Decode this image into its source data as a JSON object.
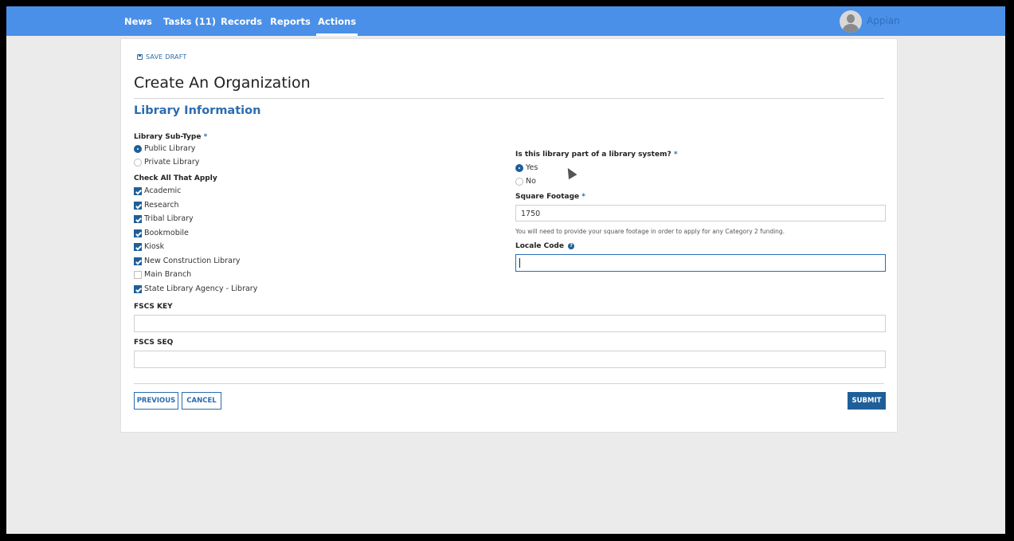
{
  "nav": {
    "tabs": [
      {
        "label": "News"
      },
      {
        "label": "Tasks (11)"
      },
      {
        "label": "Records"
      },
      {
        "label": "Reports"
      },
      {
        "label": "Actions"
      }
    ],
    "active_tab": "Actions",
    "app_name": "Appian"
  },
  "form": {
    "save_draft_label": "SAVE DRAFT",
    "title": "Create An Organization",
    "section_title": "Library Information",
    "sub_type": {
      "label": "Library Sub-Type",
      "required_mark": "*",
      "options": [
        {
          "label": "Public Library",
          "selected": true
        },
        {
          "label": "Private Library",
          "selected": false
        }
      ]
    },
    "check_all": {
      "label": "Check All That Apply",
      "options": [
        {
          "label": "Academic",
          "checked": true
        },
        {
          "label": "Research",
          "checked": true
        },
        {
          "label": "Tribal Library",
          "checked": true
        },
        {
          "label": "Bookmobile",
          "checked": true
        },
        {
          "label": "Kiosk",
          "checked": true
        },
        {
          "label": "New Construction Library",
          "checked": true
        },
        {
          "label": "Main Branch",
          "checked": false
        },
        {
          "label": "State Library Agency - Library",
          "checked": true
        }
      ]
    },
    "library_system": {
      "label": "Is this library part of a library system?",
      "required_mark": "*",
      "options": [
        {
          "label": "Yes",
          "selected": true
        },
        {
          "label": "No",
          "selected": false
        }
      ]
    },
    "square_footage": {
      "label": "Square Footage",
      "required_mark": "*",
      "value": "1750",
      "hint": "You will need to provide your square footage in order to apply for any Category 2 funding."
    },
    "locale_code": {
      "label": "Locale Code",
      "help_icon": "?",
      "value": ""
    },
    "fscs_key": {
      "label": "FSCS KEY",
      "value": ""
    },
    "fscs_seq": {
      "label": "FSCS SEQ",
      "value": ""
    },
    "buttons": {
      "previous": "PREVIOUS",
      "cancel": "CANCEL",
      "submit": "SUBMIT"
    }
  },
  "colors": {
    "navbar": "#4a90e8",
    "accent": "#2b6cb0",
    "primary_button": "#1f5f99"
  }
}
